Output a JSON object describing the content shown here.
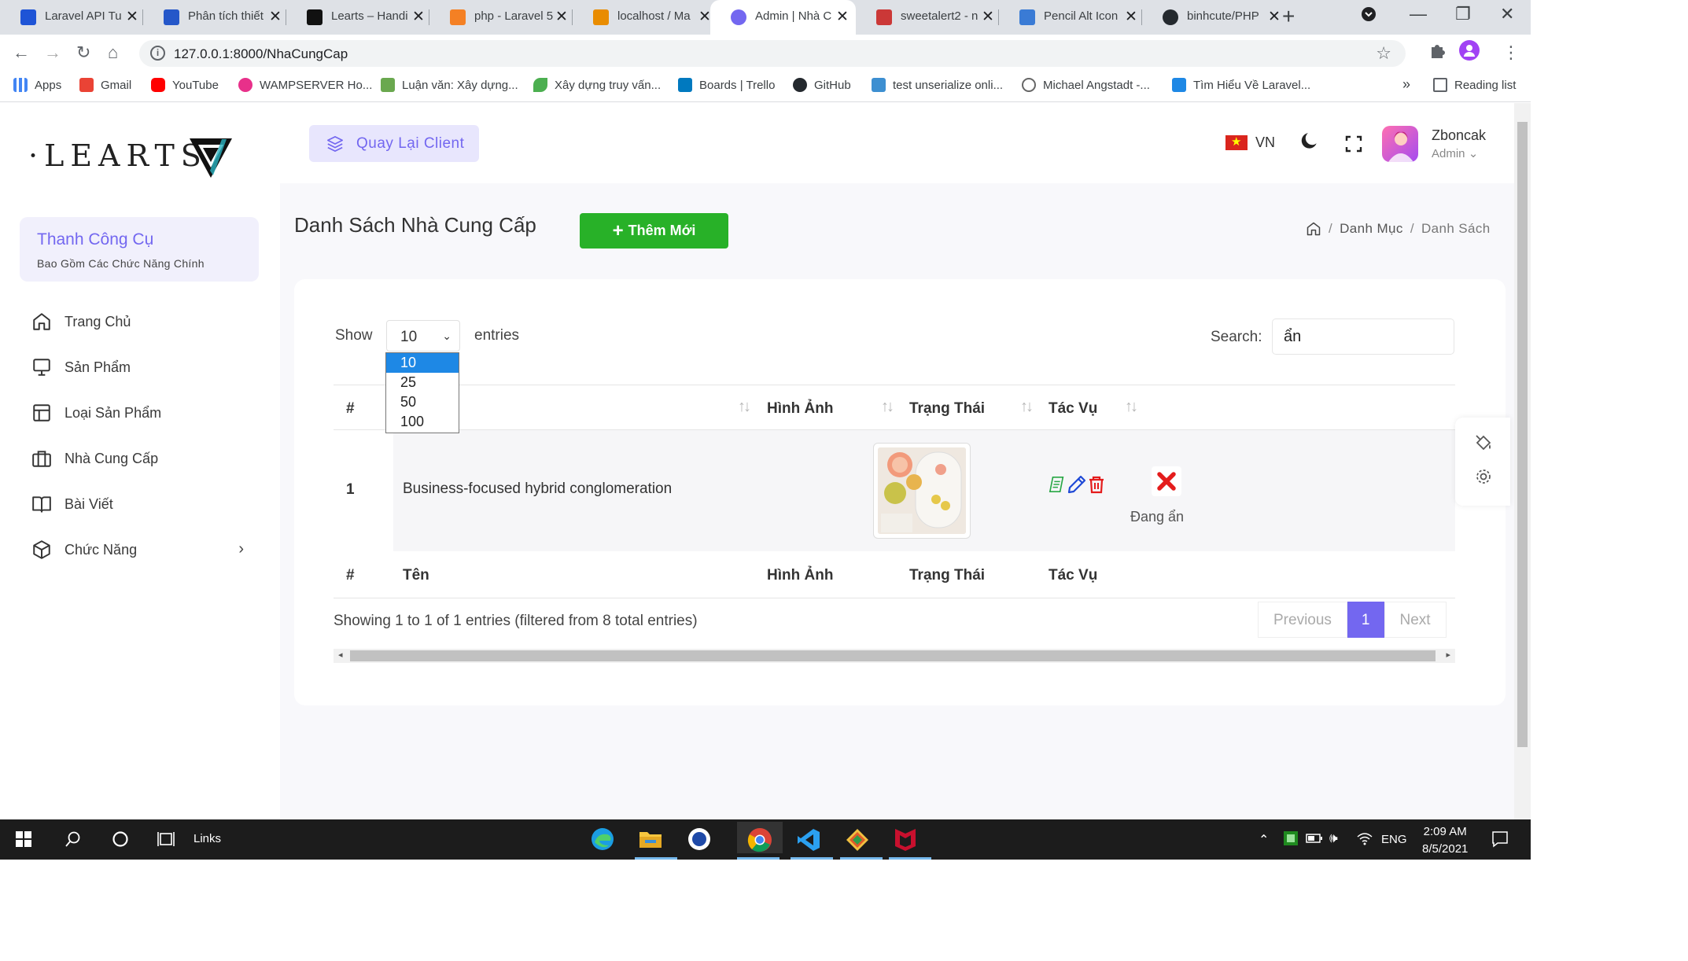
{
  "browser": {
    "tabs": [
      {
        "title": "Laravel API Tu",
        "color": "#1e54d6",
        "active": false
      },
      {
        "title": "Phân tích thiết",
        "color": "#2557c9",
        "active": false
      },
      {
        "title": "Learts – Handi",
        "color": "#111111",
        "active": false
      },
      {
        "title": "php - Laravel 5",
        "color": "#f48024",
        "active": false
      },
      {
        "title": "localhost / Ma",
        "color": "#e98c00",
        "active": false
      },
      {
        "title": "Admin | Nhà C",
        "color": "#7367f0",
        "active": true
      },
      {
        "title": "sweetalert2 - n",
        "color": "#cb3837",
        "active": false
      },
      {
        "title": "Pencil Alt Icon",
        "color": "#3a7bd5",
        "active": false
      },
      {
        "title": "binhcute/PHP",
        "color": "#24292e",
        "active": false
      }
    ],
    "url": "127.0.0.1:8000/NhaCungCap",
    "bookmarks": [
      {
        "label": "Apps",
        "color": "#4285f4"
      },
      {
        "label": "Gmail",
        "color": "#ea4335"
      },
      {
        "label": "YouTube",
        "color": "#ff0000"
      },
      {
        "label": "WAMPSERVER Ho...",
        "color": "#e8308a"
      },
      {
        "label": "Luận văn: Xây dựng...",
        "color": "#6aa84f"
      },
      {
        "label": "Xây dựng truy vấn...",
        "color": "#4caf50"
      },
      {
        "label": "Boards | Trello",
        "color": "#0079bf"
      },
      {
        "label": "GitHub",
        "color": "#24292e"
      },
      {
        "label": "test unserialize onli...",
        "color": "#3d8fd1"
      },
      {
        "label": "Michael Angstadt -...",
        "color": "#666666"
      },
      {
        "label": "Tìm Hiểu Về Laravel...",
        "color": "#1e88e5"
      }
    ],
    "bookmarks_more": "»",
    "reading_list": "Reading list"
  },
  "sidebar": {
    "logo": "·LEARTS·",
    "tool_title": "Thanh Công Cụ",
    "tool_sub": "Bao Gồm Các Chức Năng Chính",
    "items": [
      {
        "label": "Trang Chủ",
        "icon": "home-icon"
      },
      {
        "label": "Sản Phẩm",
        "icon": "monitor-icon"
      },
      {
        "label": "Loại Sản Phẩm",
        "icon": "layout-icon"
      },
      {
        "label": "Nhà Cung Cấp",
        "icon": "briefcase-icon"
      },
      {
        "label": "Bài Viết",
        "icon": "book-icon"
      },
      {
        "label": "Chức Năng",
        "icon": "box-icon"
      }
    ]
  },
  "topnav": {
    "back_client": "Quay Lại Client",
    "lang": "VN",
    "user_name": "Zboncak",
    "user_role": "Admin"
  },
  "main": {
    "title": "Danh Sách Nhà Cung Cấp",
    "add_button": "Thêm Mới",
    "breadcrumb": [
      "Danh Mục",
      "Danh Sách"
    ]
  },
  "table": {
    "show_label": "Show",
    "entries_value": "10",
    "entries_label": "entries",
    "entries_options": [
      "10",
      "25",
      "50",
      "100"
    ],
    "search_label": "Search:",
    "search_value": "ẩn",
    "columns": [
      "#",
      "Tên",
      "Hình Ảnh",
      "Trạng Thái",
      "Tác Vụ"
    ],
    "rows": [
      {
        "index": "1",
        "name": "Business-focused hybrid conglomeration",
        "status": "Đang ẩn"
      }
    ],
    "info": "Showing 1 to 1 of 1 entries (filtered from 8 total entries)",
    "pager": {
      "previous": "Previous",
      "page": "1",
      "next": "Next"
    }
  },
  "taskbar": {
    "links": "Links",
    "lang": "ENG",
    "time": "2:09 AM",
    "date": "8/5/2021"
  },
  "colors": {
    "accent": "#7367f0",
    "success": "#28b128",
    "danger": "#e41c1c"
  }
}
